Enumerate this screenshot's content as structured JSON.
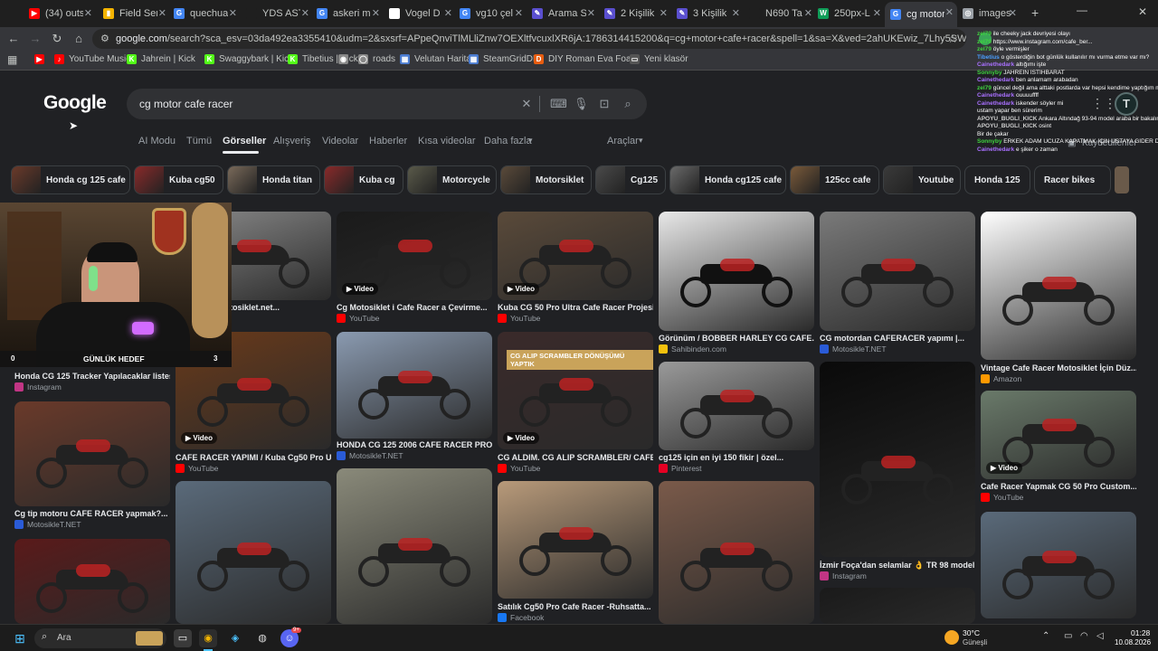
{
  "tabs": [
    {
      "label": "(34) outs",
      "color": "#ff0000",
      "glyph": "▶"
    },
    {
      "label": "Field Ser",
      "color": "#f4b400",
      "glyph": "▮"
    },
    {
      "label": "quechua",
      "color": "#4285f4",
      "glyph": "G"
    },
    {
      "label": "YDS AST",
      "color": "#1f1f1f",
      "glyph": ""
    },
    {
      "label": "askeri m",
      "color": "#4285f4",
      "glyph": "G"
    },
    {
      "label": "Vogel D",
      "color": "#ffffff",
      "glyph": "V"
    },
    {
      "label": "vg10 çel",
      "color": "#4285f4",
      "glyph": "G"
    },
    {
      "label": "Arama S",
      "color": "#5a4fcf",
      "glyph": "✎"
    },
    {
      "label": "2 Kişilik",
      "color": "#5a4fcf",
      "glyph": "✎"
    },
    {
      "label": "3 Kişilik",
      "color": "#5a4fcf",
      "glyph": "✎"
    },
    {
      "label": "N690 Ta",
      "color": "#1f1f1f",
      "glyph": ""
    },
    {
      "label": "250px-L",
      "color": "#0f9d58",
      "glyph": "W"
    },
    {
      "label": "cg motor",
      "color": "#4285f4",
      "glyph": "G",
      "active": true
    },
    {
      "label": "images",
      "color": "#9aa0a6",
      "glyph": "◎"
    }
  ],
  "address": {
    "host": "google.com",
    "path": "/search?sca_esv=03da492ea3355410&udm=2&sxsrf=APpeQnviTlMLliZnw7OEXltfvcuxlXR6jA:1786314415200&q=cg+motor+cafe+racer&spell=1&sa=X&ved=2ahUKEwiz_7Lhy5SWAxW6SPEDHWYEKEcQBSg..."
  },
  "bookmarks": [
    {
      "label": "",
      "color": "#ff0000",
      "glyph": "▶"
    },
    {
      "label": "YouTube Music",
      "color": "#ff0000",
      "glyph": "♪"
    },
    {
      "label": "Jahrein | Kick",
      "color": "#53fc18",
      "glyph": "K"
    },
    {
      "label": "Swaggybark | Kick",
      "color": "#53fc18",
      "glyph": "K"
    },
    {
      "label": "Tibetius | Kick",
      "color": "#53fc18",
      "glyph": "K"
    },
    {
      "label": "",
      "color": "#888888",
      "glyph": "◉"
    },
    {
      "label": "roads",
      "color": "#888888",
      "glyph": "◯"
    },
    {
      "label": "Velutan Harita",
      "color": "#4a7bd0",
      "glyph": "▦"
    },
    {
      "label": "SteamGridDB",
      "color": "#4a7bd0",
      "glyph": "▦"
    },
    {
      "label": "DIY Roman Eva Foa...",
      "color": "#e85d10",
      "glyph": "D"
    },
    {
      "label": "Yeni klasör",
      "color": "#555555",
      "glyph": "▭"
    }
  ],
  "google": {
    "logo": "Google",
    "query": "cg motor cafe racer",
    "nav": [
      "AI Modu",
      "Tümü",
      "Görseller",
      "Alışveriş",
      "Videolar",
      "Haberler",
      "Kısa videolar",
      "Daha fazla",
      "Araçlar"
    ],
    "chips": [
      "Honda cg 125 cafe",
      "Kuba cg50",
      "Honda titan",
      "Kuba cg",
      "Motorcycle",
      "Motorsiklet",
      "Cg125",
      "Honda cg125 cafe",
      "125cc cafe",
      "Youtube",
      "Honda 125",
      "Racer bikes"
    ]
  },
  "results": [
    {
      "caption": "r yapmak | Motosiklet.net...",
      "source": "NET",
      "src_color": "#2a5bd7",
      "video": false
    },
    {
      "caption": "Cg Motosiklet i Cafe Racer a Çevirme...",
      "source": "YouTube",
      "src_color": "#ff0000",
      "video": true
    },
    {
      "caption": "Kuba CG 50 Pro Ultra Cafe Racer Projesi",
      "source": "YouTube",
      "src_color": "#ff0000",
      "video": true
    },
    {
      "caption": "Görünüm / BOBBER HARLEY CG CAFE...",
      "source": "Sahibinden.com",
      "src_color": "#f4c20d",
      "video": false
    },
    {
      "caption": "CG motordan CAFERACER yapımı |...",
      "source": "MotosikleT.NET",
      "src_color": "#2a5bd7",
      "video": false
    },
    {
      "caption": "Vintage Cafe Racer Motosiklet İçin Düz...",
      "source": "Amazon",
      "src_color": "#ff9900",
      "video": false
    },
    {
      "caption": "Honda CG 125 Tracker Yapılacaklar listesin...",
      "source": "Instagram",
      "src_color": "#c13584",
      "video": false
    },
    {
      "caption": "CAFE RACER YAPIMI / Kuba Cg50 Pro Ultra",
      "source": "YouTube",
      "src_color": "#ff0000",
      "video": true
    },
    {
      "caption": "HONDA CG 125 2006 CAFE RACER PROJE...",
      "source": "MotosikleT.NET",
      "src_color": "#2a5bd7",
      "video": false
    },
    {
      "caption": "CG ALDIM. CG ALIP SCRAMBLER/ CAFE...",
      "source": "YouTube",
      "src_color": "#ff0000",
      "video": true
    },
    {
      "caption": "cg125 için en iyi 150 fikir | özel...",
      "source": "Pinterest",
      "src_color": "#e60023",
      "video": false
    },
    {
      "caption": "İzmir Foça'dan selamlar 👌 TR 98 model...",
      "source": "Instagram",
      "src_color": "#c13584",
      "video": false
    },
    {
      "caption": "Cafe Racer Yapmak CG 50 Pro Custom...",
      "source": "YouTube",
      "src_color": "#ff0000",
      "video": true
    },
    {
      "caption": "Cg tip motoru CAFE RACER yapmak?...",
      "source": "MotosikleT.NET",
      "src_color": "#2a5bd7",
      "video": false
    },
    {
      "caption": "Satılık Cg50 Pro Cafe Racer -Ruhsatta...",
      "source": "Facebook",
      "src_color": "#1877f2",
      "video": false
    }
  ],
  "video_label": "Video",
  "overlay_banner": "CG ALIP SCRAMBLER DÖNÜŞÜMÜ YAPTIK",
  "webcam": {
    "left_count": "0",
    "goal_label": "GÜNLÜK HEDEF",
    "right_count": "3"
  },
  "kaydedilenler": "Kaydedilenler",
  "chat": [
    {
      "user": "zel79",
      "color": "#3fd23f",
      "text": "ile cheeky jack devriyesi olayı"
    },
    {
      "user": "zel79",
      "color": "#3fd23f",
      "text": "https://www.instagram.com/cafe_ber..."
    },
    {
      "user": "zel79",
      "color": "#3fd23f",
      "text": "öyle vermişler"
    },
    {
      "user": "Tibetius",
      "color": "#4a9eff",
      "text": "o gösterdiğin bot günlük kullanılır mı vurma etme var mı?"
    },
    {
      "user": "Cainethedark",
      "color": "#a970ff",
      "text": "altığımı işte"
    },
    {
      "user": "Sonnyby",
      "color": "#3fd23f",
      "text": "JAHREİN İSTİHBARAT"
    },
    {
      "user": "Cainethedark",
      "color": "#a970ff",
      "text": "ben anlamam arabadan"
    },
    {
      "user": "zel79",
      "color": "#3fd23f",
      "text": "güncel değil ama alttaki postlarda var hepsi kendime yaptığım motorlar"
    },
    {
      "user": "Cainethedark",
      "color": "#a970ff",
      "text": "ouuuuffff"
    },
    {
      "user": "Cainethedark",
      "color": "#a970ff",
      "text": "iskender söyler mi"
    },
    {
      "user": "",
      "color": "#ff4040",
      "text": "ustam yapar ben sürerim"
    },
    {
      "user": "APOYU_BUGLI_KICK",
      "color": "#cfcfcf",
      "text": "Ankara Altındağ 93-94 model araba bir bakalım önceden alalım"
    },
    {
      "user": "APOYU_BUGLI_KICK",
      "color": "#cfcfcf",
      "text": "osint"
    },
    {
      "user": "",
      "color": "#ff4040",
      "text": "Bir de çakar"
    },
    {
      "user": "Sonnyby",
      "color": "#3fd23f",
      "text": "ERKEK ADAM UCUZA KAPATMAK İÇİN USTAYA GİDER DAHA ÇOK ÖDER"
    },
    {
      "user": "Cainethedark",
      "color": "#a970ff",
      "text": "e şiker o zaman"
    }
  ],
  "taskbar": {
    "search_label": "Ara",
    "weather_temp": "30°C",
    "weather_text": "Güneşli",
    "time": "01:28",
    "date": "10.08.2026",
    "discord_badge": "9+"
  }
}
